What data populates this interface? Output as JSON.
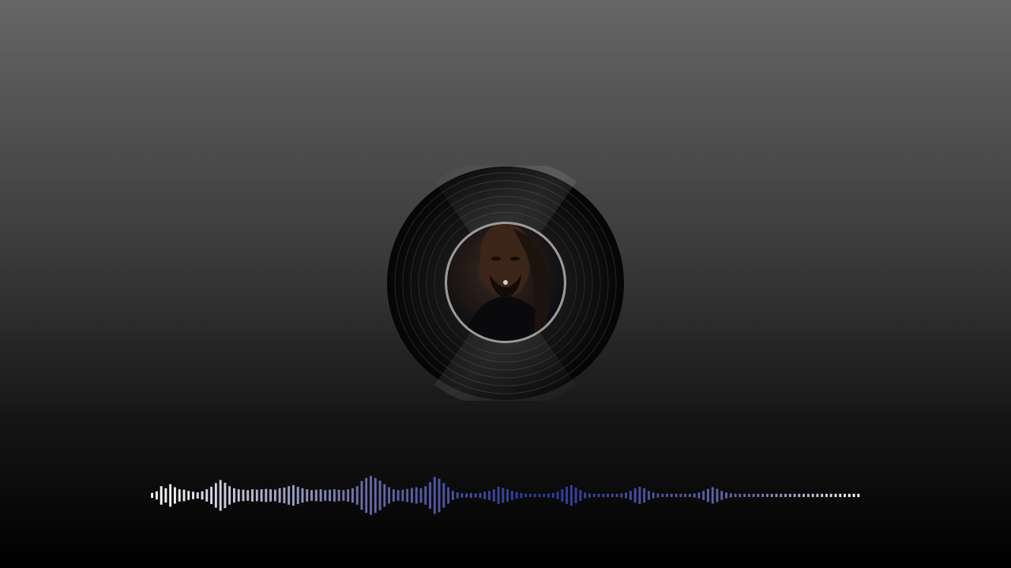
{
  "scene": {
    "background_top": "#666666",
    "background_bottom": "#000000"
  },
  "record": {
    "type": "vinyl-record",
    "label_image": "artist-portrait",
    "label_ring_color": "#9a9a9a"
  },
  "visualizer": {
    "type": "audio-waveform-bars",
    "color_start": "#ffffff",
    "color_mid": "#6a6aaa",
    "color_deep": "#2a3a9a",
    "color_end": "#ffffff",
    "levels": [
      0.12,
      0.2,
      0.45,
      0.35,
      0.55,
      0.4,
      0.3,
      0.28,
      0.22,
      0.18,
      0.15,
      0.2,
      0.3,
      0.42,
      0.6,
      0.75,
      0.62,
      0.45,
      0.35,
      0.3,
      0.28,
      0.26,
      0.3,
      0.28,
      0.3,
      0.32,
      0.3,
      0.28,
      0.35,
      0.38,
      0.45,
      0.5,
      0.42,
      0.35,
      0.3,
      0.26,
      0.28,
      0.3,
      0.26,
      0.28,
      0.3,
      0.28,
      0.26,
      0.3,
      0.35,
      0.45,
      0.7,
      0.85,
      0.95,
      0.85,
      0.72,
      0.55,
      0.4,
      0.3,
      0.26,
      0.28,
      0.32,
      0.36,
      0.4,
      0.35,
      0.45,
      0.65,
      0.9,
      0.82,
      0.6,
      0.4,
      0.22,
      0.14,
      0.1,
      0.1,
      0.12,
      0.1,
      0.12,
      0.18,
      0.22,
      0.3,
      0.42,
      0.36,
      0.3,
      0.22,
      0.16,
      0.12,
      0.08,
      0.08,
      0.08,
      0.08,
      0.08,
      0.1,
      0.12,
      0.18,
      0.3,
      0.42,
      0.5,
      0.38,
      0.26,
      0.14,
      0.1,
      0.08,
      0.08,
      0.08,
      0.08,
      0.08,
      0.08,
      0.1,
      0.14,
      0.22,
      0.35,
      0.42,
      0.35,
      0.22,
      0.14,
      0.1,
      0.08,
      0.08,
      0.08,
      0.08,
      0.08,
      0.08,
      0.08,
      0.1,
      0.14,
      0.22,
      0.32,
      0.4,
      0.32,
      0.22,
      0.14,
      0.1,
      0.08,
      0.08,
      0.08,
      0.08,
      0.08,
      0.08,
      0.08,
      0.08,
      0.08,
      0.08,
      0.08,
      0.08,
      0.08,
      0.08,
      0.08,
      0.08,
      0.08,
      0.08,
      0.08,
      0.08,
      0.08,
      0.08,
      0.08,
      0.08,
      0.08,
      0.08,
      0.08,
      0.08
    ]
  }
}
